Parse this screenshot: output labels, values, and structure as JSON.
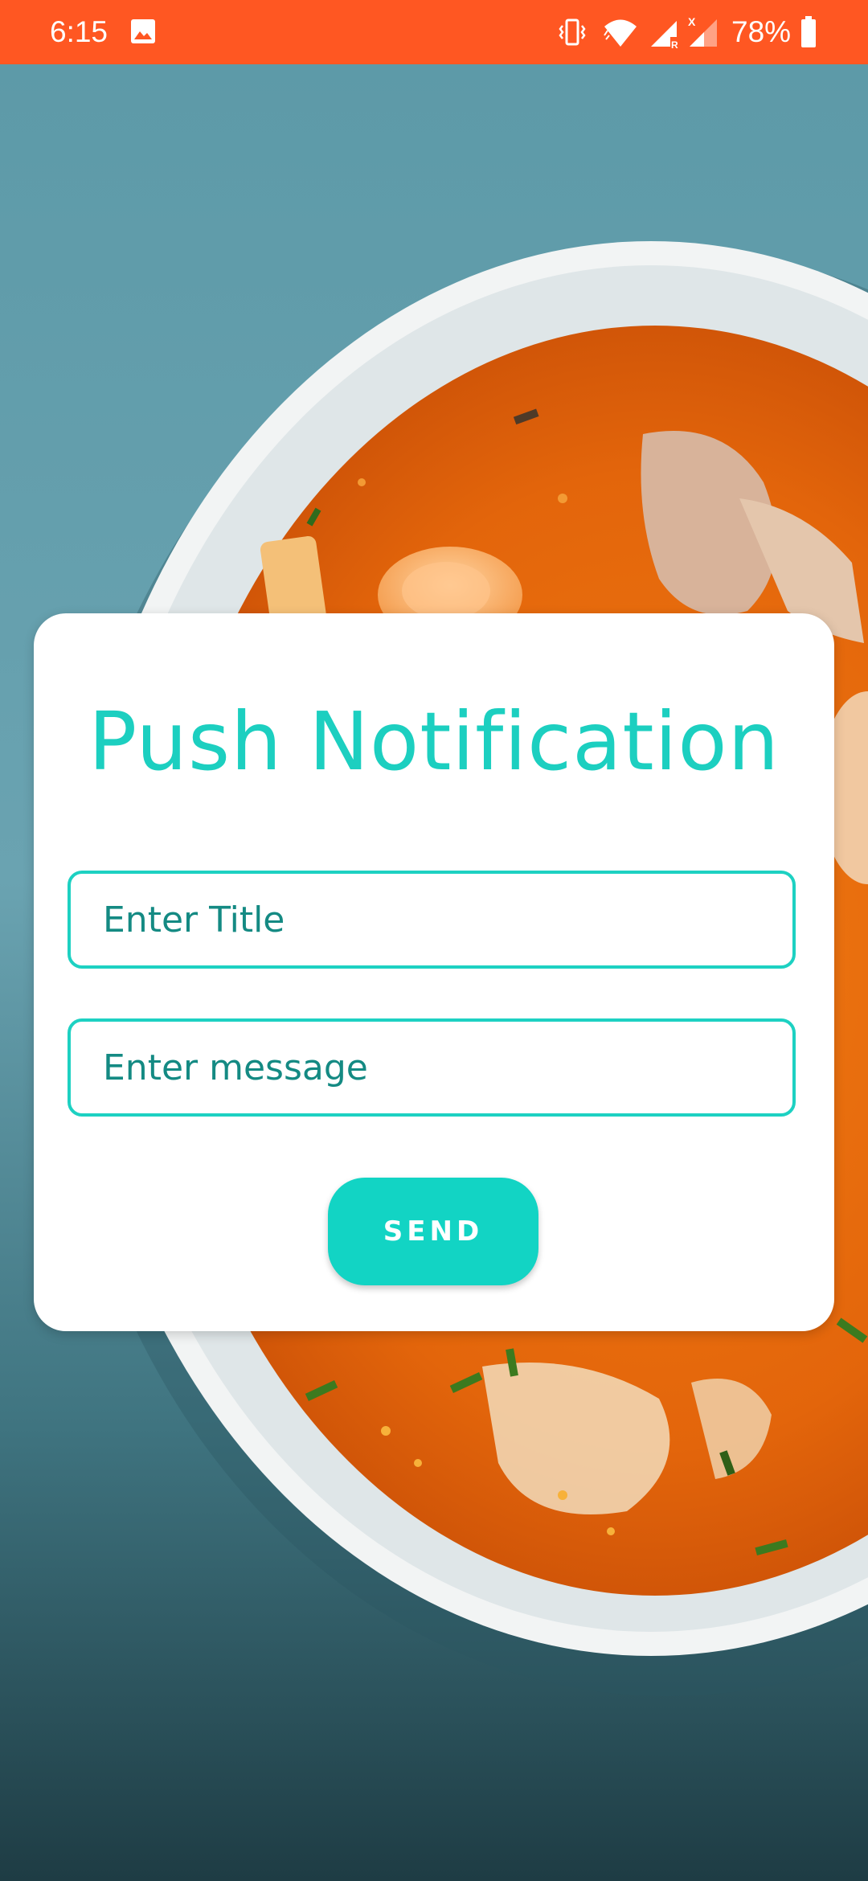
{
  "status_bar": {
    "time": "6:15",
    "battery_percent": "78%",
    "background_color": "#ff5722",
    "icons": [
      "image-icon",
      "vibrate-icon",
      "wifi-icon",
      "signal-roaming-icon",
      "signal-no-service-icon",
      "battery-icon"
    ]
  },
  "background": {
    "icon": "soup-bowl-photo"
  },
  "card": {
    "title": "Push Notification",
    "accent_color": "#1dd1c2",
    "title_input": {
      "value": "",
      "placeholder": "Enter Title"
    },
    "message_input": {
      "value": "",
      "placeholder": "Enter message"
    },
    "send_label": "SEND"
  }
}
